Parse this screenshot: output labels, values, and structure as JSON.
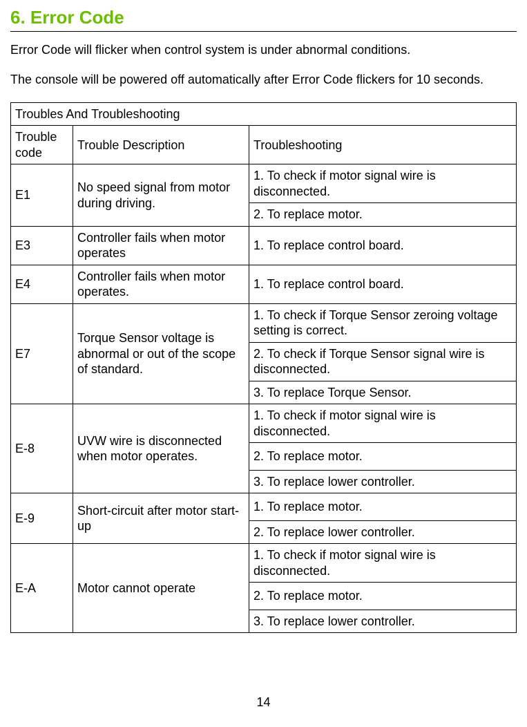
{
  "heading": "6.  Error Code",
  "intro1": "Error Code will flicker when control system is under abnormal conditions.",
  "intro2": "The console will be powered off automatically after Error Code flickers for 10 seconds.",
  "table": {
    "title": "Troubles And Troubleshooting",
    "headers": {
      "code": "Trouble code",
      "desc": "Trouble Description",
      "shoot": "Troubleshooting"
    },
    "rows": {
      "e1": {
        "code": "E1",
        "desc": "No speed signal from motor during driving.",
        "shoot1": "1. To check if motor signal wire is disconnected.",
        "shoot2": "2. To replace motor."
      },
      "e3": {
        "code": "E3",
        "desc": "Controller fails when motor operates",
        "shoot1": "1. To replace control board."
      },
      "e4": {
        "code": "E4",
        "desc": "Controller fails when motor operates.",
        "shoot1": "1. To replace control board."
      },
      "e7": {
        "code": "E7",
        "desc": "Torque Sensor voltage is abnormal or out of the scope of standard.",
        "shoot1": "1. To check if Torque Sensor zeroing voltage setting is correct.",
        "shoot2": "2. To check if Torque Sensor signal wire is disconnected.",
        "shoot3": "3. To replace Torque Sensor."
      },
      "e8": {
        "code": "E-8",
        "desc": "UVW wire is disconnected when motor operates.",
        "shoot1": "1. To check if motor signal wire is disconnected.",
        "shoot2": "2. To replace motor.",
        "shoot3": "3. To replace lower controller."
      },
      "e9": {
        "code": "E-9",
        "desc": "Short-circuit after motor start-up",
        "shoot1": "1. To replace motor.",
        "shoot2": "2. To replace lower controller."
      },
      "ea": {
        "code": "E-A",
        "desc": "Motor cannot operate",
        "shoot1": "1. To check if motor signal wire is disconnected.",
        "shoot2": "2. To replace motor.",
        "shoot3": "3. To replace lower controller."
      }
    }
  },
  "pageNumber": "14"
}
